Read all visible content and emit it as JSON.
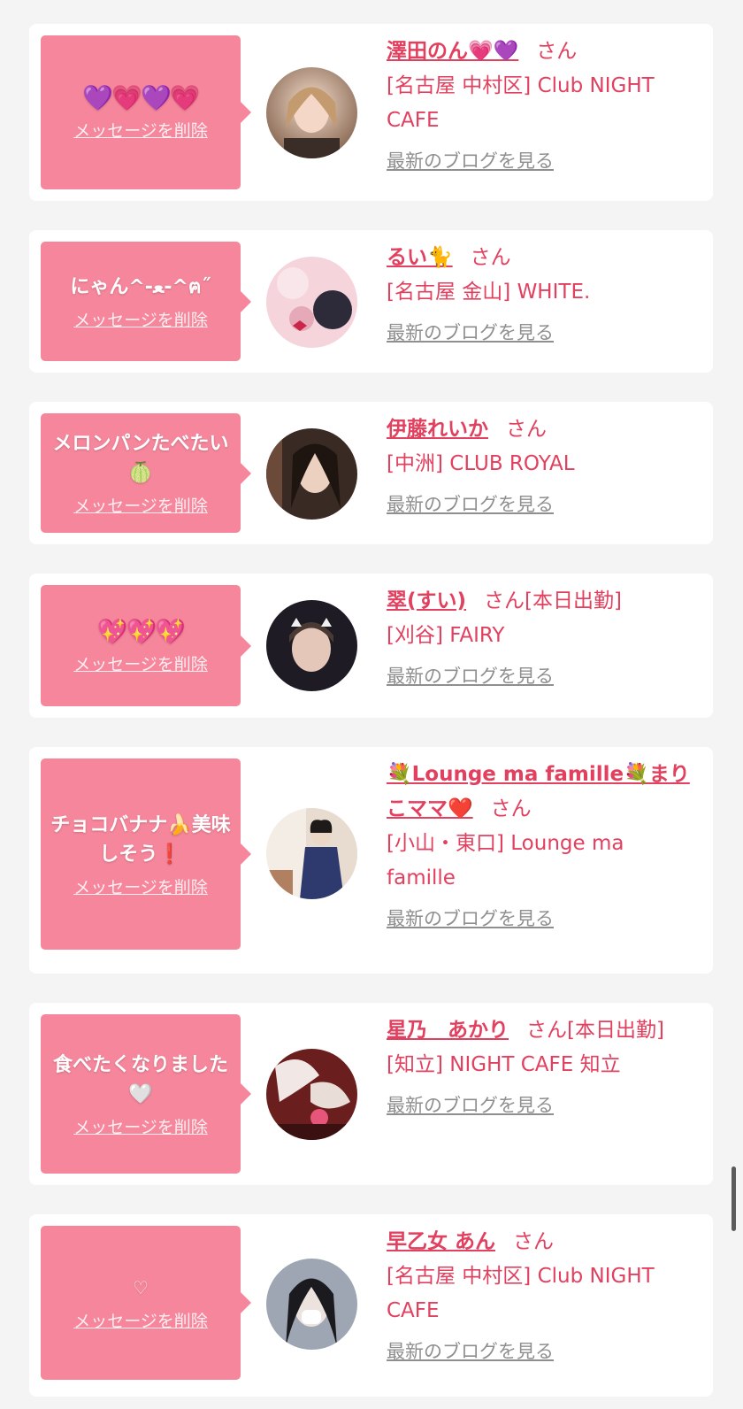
{
  "messages": [
    {
      "text": "💜💗💜💗",
      "text_style": "emoji",
      "delete_label": "メッセージを削除",
      "name": "澤田のん💗💜",
      "honorific": "さん",
      "status": "",
      "shop": "[名古屋 中村区] Club NIGHT CAFE",
      "blog_label": "最新のブログを見る",
      "avatar_icon": "avatar-photo",
      "avatar_colors": [
        "#c9a58a",
        "#6b4a3a"
      ]
    },
    {
      "text": "にゃん^-ﻌ-^ฅ˝",
      "text_style": "",
      "delete_label": "メッセージを削除",
      "name": "るい🐈",
      "honorific": "さん",
      "status": "",
      "shop": "[名古屋 金山] WHITE.",
      "blog_label": "最新のブログを見る",
      "avatar_icon": "avatar-photo",
      "avatar_colors": [
        "#f2c9d3",
        "#2d2a3a"
      ]
    },
    {
      "text": "メロンパンたべたい🍈",
      "text_style": "",
      "delete_label": "メッセージを削除",
      "name": "伊藤れいか",
      "honorific": "さん",
      "status": "",
      "shop": "[中洲] CLUB ROYAL",
      "blog_label": "最新のブログを見る",
      "avatar_icon": "avatar-photo",
      "avatar_colors": [
        "#3a2a24",
        "#e9cfc0"
      ]
    },
    {
      "text": "💖💖💖",
      "text_style": "emoji",
      "delete_label": "メッセージを削除",
      "name": "翠(すい)",
      "honorific": "さん",
      "status": "[本日出勤]",
      "shop": "[刈谷] FAIRY",
      "blog_label": "最新のブログを見る",
      "avatar_icon": "avatar-photo",
      "avatar_colors": [
        "#1e1b24",
        "#d6b8a8"
      ]
    },
    {
      "text": "チョコバナナ🍌美味しそう❗",
      "text_style": "",
      "delete_label": "メッセージを削除",
      "name": "💐Lounge ma famille💐まりこママ❤️",
      "honorific": "さん",
      "status": "",
      "shop": "[小山・東口] Lounge ma famille",
      "blog_label": "最新のブログを見る",
      "avatar_icon": "avatar-photo",
      "avatar_colors": [
        "#f3ede6",
        "#2e3a6e"
      ]
    },
    {
      "text": "食べたくなりました🤍",
      "text_style": "",
      "delete_label": "メッセージを削除",
      "name": "星乃　あかり",
      "honorific": "さん",
      "status": "[本日出勤]",
      "shop": "[知立] NIGHT CAFE 知立",
      "blog_label": "最新のブログを見る",
      "avatar_icon": "avatar-photo",
      "avatar_colors": [
        "#6a1e1e",
        "#f1e7e4"
      ]
    },
    {
      "text": "♡",
      "text_style": "heart-outline",
      "delete_label": "メッセージを削除",
      "name": "早乙女 あん",
      "honorific": "さん",
      "status": "",
      "shop": "[名古屋 中村区] Club NIGHT CAFE",
      "blog_label": "最新のブログを見る",
      "avatar_icon": "avatar-photo",
      "avatar_colors": [
        "#9ea6b3",
        "#2a2a2e"
      ]
    }
  ],
  "colors": {
    "bubble": "#f5869b",
    "accent": "#e2405f",
    "link_gray": "#8f8f8f",
    "background": "#f4f4f4"
  }
}
